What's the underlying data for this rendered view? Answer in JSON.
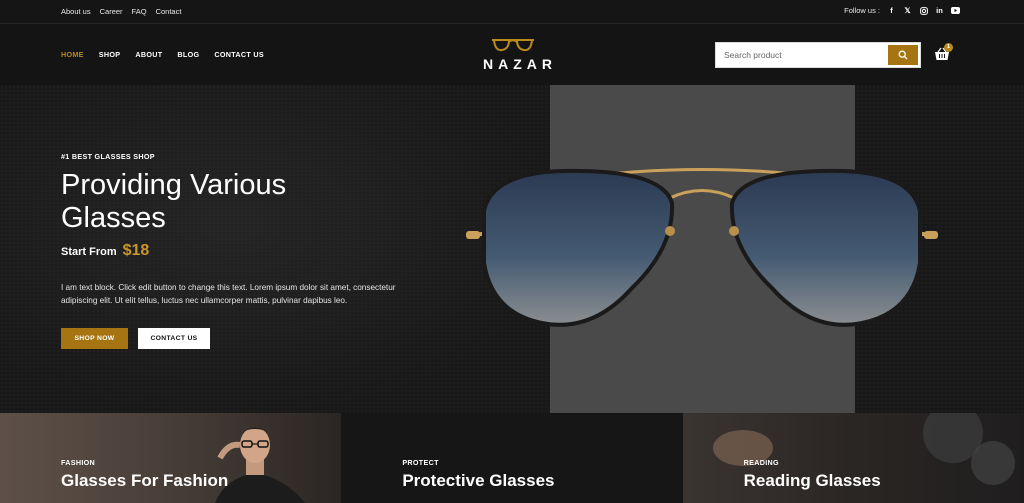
{
  "topbar": {
    "links": [
      "About us",
      "Career",
      "FAQ",
      "Contact"
    ],
    "follow_label": "Follow us :",
    "social_icons": [
      "facebook-icon",
      "x-icon",
      "instagram-icon",
      "linkedin-icon",
      "youtube-icon"
    ]
  },
  "nav": {
    "items": [
      "HOME",
      "SHOP",
      "ABOUT",
      "BLOG",
      "CONTACT US"
    ],
    "active_index": 0
  },
  "logo": {
    "text": "NAZAR"
  },
  "search": {
    "placeholder": "Search product"
  },
  "cart": {
    "count": "1"
  },
  "hero": {
    "eyebrow": "#1 BEST GLASSES SHOP",
    "title": "Providing Various Glasses",
    "price_label": "Start From",
    "price": "$18",
    "description": "I am text block. Click edit button to change this text. Lorem ipsum dolor sit amet, consectetur adipiscing elit. Ut elit tellus, luctus nec ullamcorper mattis, pulvinar dapibus leo.",
    "primary_button": "SHOP NOW",
    "secondary_button": "CONTACT US"
  },
  "categories": [
    {
      "tag": "FASHION",
      "title": "Glasses For Fashion"
    },
    {
      "tag": "PROTECT",
      "title": "Protective Glasses"
    },
    {
      "tag": "READING",
      "title": "Reading Glasses"
    }
  ],
  "colors": {
    "accent": "#a67512",
    "accent_text": "#c9962a",
    "background": "#141414"
  }
}
